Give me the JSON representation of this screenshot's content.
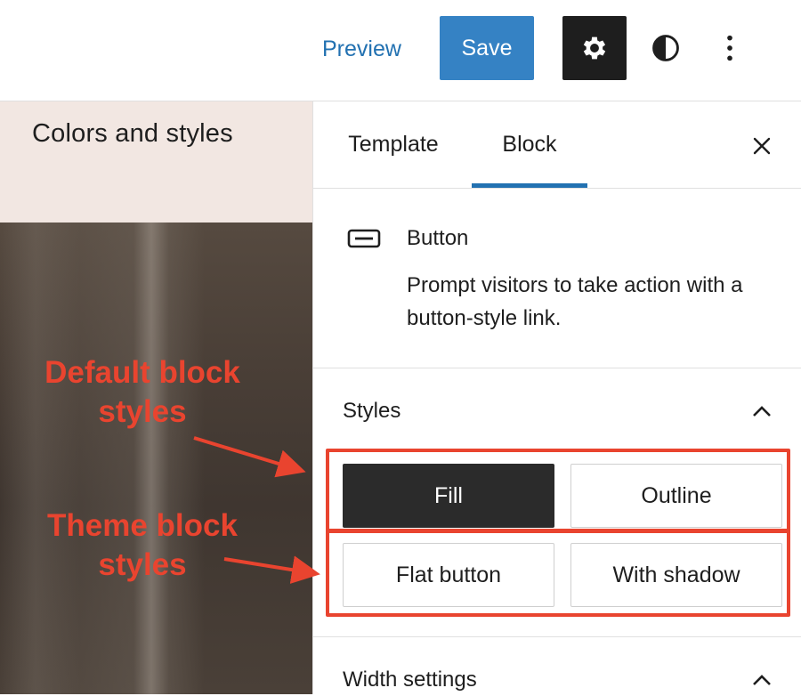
{
  "toolbar": {
    "preview_label": "Preview",
    "save_label": "Save",
    "settings_icon": "gear-icon",
    "styles_icon": "half-circle-contrast-icon",
    "more_icon": "vertical-ellipsis-icon"
  },
  "canvas": {
    "title": "Colors and styles"
  },
  "annotations": {
    "default_line1": "Default block",
    "default_line2": "styles",
    "theme_line1": "Theme block",
    "theme_line2": "styles",
    "color": "#e9442f"
  },
  "sidebar": {
    "tabs": [
      {
        "label": "Template",
        "active": false
      },
      {
        "label": "Block",
        "active": true
      }
    ],
    "close_icon": "close-icon",
    "block": {
      "icon": "button-block-icon",
      "name": "Button",
      "description": "Prompt visitors to take action with a button-style link."
    },
    "styles_panel": {
      "title": "Styles",
      "toggle_icon": "chevron-up-icon",
      "default_styles": [
        {
          "label": "Fill",
          "selected": true
        },
        {
          "label": "Outline",
          "selected": false
        }
      ],
      "theme_styles": [
        {
          "label": "Flat button",
          "selected": false
        },
        {
          "label": "With shadow",
          "selected": false
        }
      ]
    },
    "width_panel": {
      "title": "Width settings",
      "toggle_icon": "chevron-up-icon"
    }
  },
  "colors": {
    "accent": "#2271b1",
    "save_bg": "#3582c4",
    "dark": "#1e1e1e",
    "canvas_header_bg": "#f2e7e2"
  }
}
